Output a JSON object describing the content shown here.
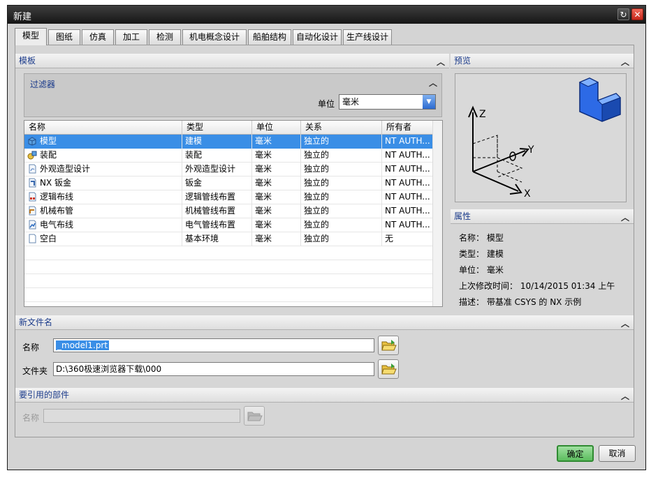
{
  "window": {
    "title": "新建"
  },
  "tabs": [
    "模型",
    "图纸",
    "仿真",
    "加工",
    "检测",
    "机电概念设计",
    "船舶结构",
    "自动化设计",
    "生产线设计"
  ],
  "templates": {
    "section_title": "模板",
    "filter": {
      "title": "过滤器",
      "unit_label": "单位",
      "unit_value": "毫米"
    },
    "columns": [
      "名称",
      "类型",
      "单位",
      "关系",
      "所有者"
    ],
    "rows": [
      {
        "name": "模型",
        "type": "建模",
        "unit": "毫米",
        "relation": "独立的",
        "owner": "NT AUTH...",
        "icon": "model-icon"
      },
      {
        "name": "装配",
        "type": "装配",
        "unit": "毫米",
        "relation": "独立的",
        "owner": "NT AUTH...",
        "icon": "assembly-icon"
      },
      {
        "name": "外观造型设计",
        "type": "外观造型设计",
        "unit": "毫米",
        "relation": "独立的",
        "owner": "NT AUTH...",
        "icon": "shape-studio-icon"
      },
      {
        "name": "NX 钣金",
        "type": "钣金",
        "unit": "毫米",
        "relation": "独立的",
        "owner": "NT AUTH...",
        "icon": "sheet-metal-icon"
      },
      {
        "name": "逻辑布线",
        "type": "逻辑管线布置",
        "unit": "毫米",
        "relation": "独立的",
        "owner": "NT AUTH...",
        "icon": "logical-routing-icon"
      },
      {
        "name": "机械布管",
        "type": "机械管线布置",
        "unit": "毫米",
        "relation": "独立的",
        "owner": "NT AUTH...",
        "icon": "mechanical-routing-icon"
      },
      {
        "name": "电气布线",
        "type": "电气管线布置",
        "unit": "毫米",
        "relation": "独立的",
        "owner": "NT AUTH...",
        "icon": "electrical-routing-icon"
      },
      {
        "name": "空白",
        "type": "基本环境",
        "unit": "毫米",
        "relation": "独立的",
        "owner": "无",
        "icon": "blank-icon"
      }
    ]
  },
  "preview": {
    "section_title": "预览",
    "axes": {
      "z": "Z",
      "y": "Y",
      "x": "X"
    }
  },
  "properties": {
    "section_title": "属性",
    "name": "名称： 模型",
    "type": "类型： 建模",
    "unit": "单位： 毫米",
    "modified": "上次修改时间： 10/14/2015 01:34 上午",
    "description": "描述： 带基准 CSYS 的 NX 示例"
  },
  "new_file": {
    "section_title": "新文件名",
    "name_label": "名称",
    "name_value": "_model1.prt",
    "folder_label": "文件夹",
    "folder_value": "D:\\360极速浏览器下载\\000"
  },
  "referenced_part": {
    "section_title": "要引用的部件",
    "name_label": "名称",
    "name_value": ""
  },
  "buttons": {
    "ok": "确定",
    "cancel": "取消"
  }
}
